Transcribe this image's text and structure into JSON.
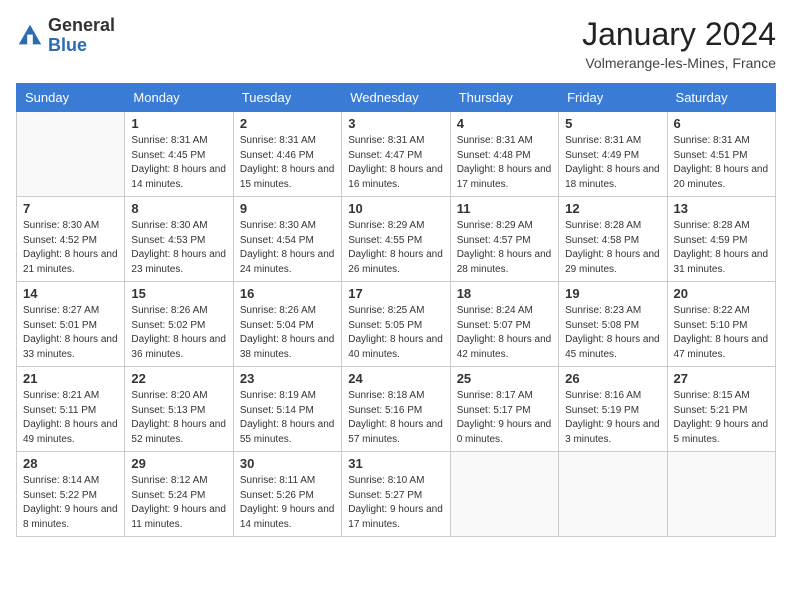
{
  "header": {
    "logo_general": "General",
    "logo_blue": "Blue",
    "month_year": "January 2024",
    "location": "Volmerange-les-Mines, France"
  },
  "days_of_week": [
    "Sunday",
    "Monday",
    "Tuesday",
    "Wednesday",
    "Thursday",
    "Friday",
    "Saturday"
  ],
  "weeks": [
    [
      {
        "day": "",
        "sunrise": "",
        "sunset": "",
        "daylight": "",
        "empty": true
      },
      {
        "day": "1",
        "sunrise": "Sunrise: 8:31 AM",
        "sunset": "Sunset: 4:45 PM",
        "daylight": "Daylight: 8 hours and 14 minutes."
      },
      {
        "day": "2",
        "sunrise": "Sunrise: 8:31 AM",
        "sunset": "Sunset: 4:46 PM",
        "daylight": "Daylight: 8 hours and 15 minutes."
      },
      {
        "day": "3",
        "sunrise": "Sunrise: 8:31 AM",
        "sunset": "Sunset: 4:47 PM",
        "daylight": "Daylight: 8 hours and 16 minutes."
      },
      {
        "day": "4",
        "sunrise": "Sunrise: 8:31 AM",
        "sunset": "Sunset: 4:48 PM",
        "daylight": "Daylight: 8 hours and 17 minutes."
      },
      {
        "day": "5",
        "sunrise": "Sunrise: 8:31 AM",
        "sunset": "Sunset: 4:49 PM",
        "daylight": "Daylight: 8 hours and 18 minutes."
      },
      {
        "day": "6",
        "sunrise": "Sunrise: 8:31 AM",
        "sunset": "Sunset: 4:51 PM",
        "daylight": "Daylight: 8 hours and 20 minutes."
      }
    ],
    [
      {
        "day": "7",
        "sunrise": "Sunrise: 8:30 AM",
        "sunset": "Sunset: 4:52 PM",
        "daylight": "Daylight: 8 hours and 21 minutes."
      },
      {
        "day": "8",
        "sunrise": "Sunrise: 8:30 AM",
        "sunset": "Sunset: 4:53 PM",
        "daylight": "Daylight: 8 hours and 23 minutes."
      },
      {
        "day": "9",
        "sunrise": "Sunrise: 8:30 AM",
        "sunset": "Sunset: 4:54 PM",
        "daylight": "Daylight: 8 hours and 24 minutes."
      },
      {
        "day": "10",
        "sunrise": "Sunrise: 8:29 AM",
        "sunset": "Sunset: 4:55 PM",
        "daylight": "Daylight: 8 hours and 26 minutes."
      },
      {
        "day": "11",
        "sunrise": "Sunrise: 8:29 AM",
        "sunset": "Sunset: 4:57 PM",
        "daylight": "Daylight: 8 hours and 28 minutes."
      },
      {
        "day": "12",
        "sunrise": "Sunrise: 8:28 AM",
        "sunset": "Sunset: 4:58 PM",
        "daylight": "Daylight: 8 hours and 29 minutes."
      },
      {
        "day": "13",
        "sunrise": "Sunrise: 8:28 AM",
        "sunset": "Sunset: 4:59 PM",
        "daylight": "Daylight: 8 hours and 31 minutes."
      }
    ],
    [
      {
        "day": "14",
        "sunrise": "Sunrise: 8:27 AM",
        "sunset": "Sunset: 5:01 PM",
        "daylight": "Daylight: 8 hours and 33 minutes."
      },
      {
        "day": "15",
        "sunrise": "Sunrise: 8:26 AM",
        "sunset": "Sunset: 5:02 PM",
        "daylight": "Daylight: 8 hours and 36 minutes."
      },
      {
        "day": "16",
        "sunrise": "Sunrise: 8:26 AM",
        "sunset": "Sunset: 5:04 PM",
        "daylight": "Daylight: 8 hours and 38 minutes."
      },
      {
        "day": "17",
        "sunrise": "Sunrise: 8:25 AM",
        "sunset": "Sunset: 5:05 PM",
        "daylight": "Daylight: 8 hours and 40 minutes."
      },
      {
        "day": "18",
        "sunrise": "Sunrise: 8:24 AM",
        "sunset": "Sunset: 5:07 PM",
        "daylight": "Daylight: 8 hours and 42 minutes."
      },
      {
        "day": "19",
        "sunrise": "Sunrise: 8:23 AM",
        "sunset": "Sunset: 5:08 PM",
        "daylight": "Daylight: 8 hours and 45 minutes."
      },
      {
        "day": "20",
        "sunrise": "Sunrise: 8:22 AM",
        "sunset": "Sunset: 5:10 PM",
        "daylight": "Daylight: 8 hours and 47 minutes."
      }
    ],
    [
      {
        "day": "21",
        "sunrise": "Sunrise: 8:21 AM",
        "sunset": "Sunset: 5:11 PM",
        "daylight": "Daylight: 8 hours and 49 minutes."
      },
      {
        "day": "22",
        "sunrise": "Sunrise: 8:20 AM",
        "sunset": "Sunset: 5:13 PM",
        "daylight": "Daylight: 8 hours and 52 minutes."
      },
      {
        "day": "23",
        "sunrise": "Sunrise: 8:19 AM",
        "sunset": "Sunset: 5:14 PM",
        "daylight": "Daylight: 8 hours and 55 minutes."
      },
      {
        "day": "24",
        "sunrise": "Sunrise: 8:18 AM",
        "sunset": "Sunset: 5:16 PM",
        "daylight": "Daylight: 8 hours and 57 minutes."
      },
      {
        "day": "25",
        "sunrise": "Sunrise: 8:17 AM",
        "sunset": "Sunset: 5:17 PM",
        "daylight": "Daylight: 9 hours and 0 minutes."
      },
      {
        "day": "26",
        "sunrise": "Sunrise: 8:16 AM",
        "sunset": "Sunset: 5:19 PM",
        "daylight": "Daylight: 9 hours and 3 minutes."
      },
      {
        "day": "27",
        "sunrise": "Sunrise: 8:15 AM",
        "sunset": "Sunset: 5:21 PM",
        "daylight": "Daylight: 9 hours and 5 minutes."
      }
    ],
    [
      {
        "day": "28",
        "sunrise": "Sunrise: 8:14 AM",
        "sunset": "Sunset: 5:22 PM",
        "daylight": "Daylight: 9 hours and 8 minutes."
      },
      {
        "day": "29",
        "sunrise": "Sunrise: 8:12 AM",
        "sunset": "Sunset: 5:24 PM",
        "daylight": "Daylight: 9 hours and 11 minutes."
      },
      {
        "day": "30",
        "sunrise": "Sunrise: 8:11 AM",
        "sunset": "Sunset: 5:26 PM",
        "daylight": "Daylight: 9 hours and 14 minutes."
      },
      {
        "day": "31",
        "sunrise": "Sunrise: 8:10 AM",
        "sunset": "Sunset: 5:27 PM",
        "daylight": "Daylight: 9 hours and 17 minutes."
      },
      {
        "day": "",
        "sunrise": "",
        "sunset": "",
        "daylight": "",
        "empty": true
      },
      {
        "day": "",
        "sunrise": "",
        "sunset": "",
        "daylight": "",
        "empty": true
      },
      {
        "day": "",
        "sunrise": "",
        "sunset": "",
        "daylight": "",
        "empty": true
      }
    ]
  ]
}
